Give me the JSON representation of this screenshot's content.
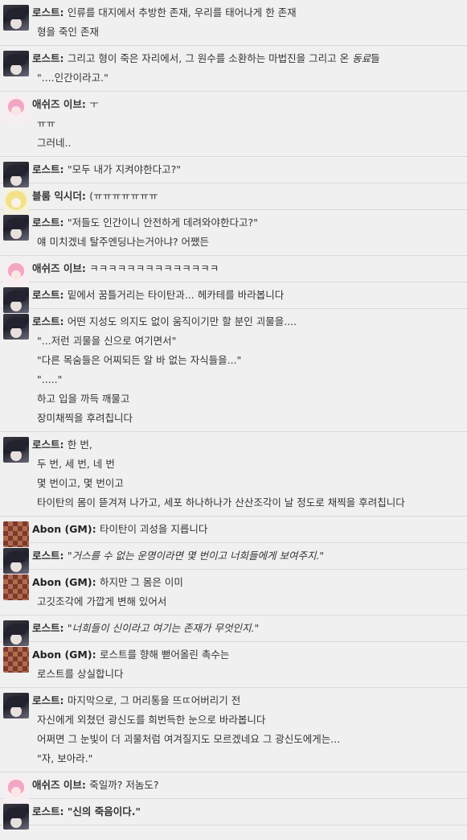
{
  "messages": [
    {
      "speaker": "로스트",
      "avatar": "rost",
      "lines": [
        {
          "segments": [
            {
              "text": "인류를 대지에서 추방한 존재, 우리를 태어나게 한 존재"
            }
          ]
        },
        {
          "segments": [
            {
              "text": "형을 죽인 존재"
            }
          ]
        }
      ]
    },
    {
      "speaker": "로스트",
      "avatar": "rost",
      "lines": [
        {
          "segments": [
            {
              "text": "그리고 형이 죽은 자리에서, 그 원수를 소환하는 마법진을 그리고 온 "
            },
            {
              "text": "동료",
              "style": "em"
            },
            {
              "text": "들"
            }
          ]
        },
        {
          "segments": [
            {
              "text": "\"....인간이라고.\""
            }
          ]
        }
      ]
    },
    {
      "speaker": "애쉬즈 이브",
      "avatar": "eve",
      "lines": [
        {
          "segments": [
            {
              "text": "ㅜ"
            }
          ]
        },
        {
          "segments": [
            {
              "text": "ㅠㅠ"
            }
          ]
        },
        {
          "segments": [
            {
              "text": "그러네.."
            }
          ]
        }
      ]
    },
    {
      "speaker": "로스트",
      "avatar": "rost",
      "lines": [
        {
          "segments": [
            {
              "text": "\"모두 내가 지켜야한다고?\""
            }
          ]
        }
      ]
    },
    {
      "speaker": "블룸 익시더",
      "avatar": "bloom",
      "lines": [
        {
          "segments": [
            {
              "text": "(ㅠㅠㅠㅠㅠㅠㅠ"
            }
          ]
        }
      ]
    },
    {
      "speaker": "로스트",
      "avatar": "rost",
      "lines": [
        {
          "segments": [
            {
              "text": "\"저들도 인간이니 안전하게 데려와야한다고?\""
            }
          ]
        },
        {
          "segments": [
            {
              "text": "얘 미치겠네 탈주엔딩나는거아냐? 어쨌든"
            }
          ]
        }
      ]
    },
    {
      "speaker": "애쉬즈 이브",
      "avatar": "eve",
      "lines": [
        {
          "segments": [
            {
              "text": "ㅋㅋㅋㅋㅋㅋㅋㅋㅋㅋㅋㅋㅋㅋ"
            }
          ]
        }
      ]
    },
    {
      "speaker": "로스트",
      "avatar": "rost",
      "lines": [
        {
          "segments": [
            {
              "text": "밑에서 꿈틀거리는 타이탄과... 헤카테를 바라봅니다"
            }
          ]
        }
      ]
    },
    {
      "speaker": "로스트",
      "avatar": "rost",
      "lines": [
        {
          "segments": [
            {
              "text": "어떤 지성도 의지도 없이 움직이기만 할 분인 괴물을...."
            }
          ]
        },
        {
          "segments": [
            {
              "text": "\"...저런 괴물을 신으로 여기면서\""
            }
          ]
        },
        {
          "segments": [
            {
              "text": "\"다른 목숨들은 어찌되든 알 바 없는 자식들을...\""
            }
          ]
        },
        {
          "segments": [
            {
              "text": "\".....\""
            }
          ]
        },
        {
          "segments": [
            {
              "text": "하고 입을 까득 깨물고"
            }
          ]
        },
        {
          "segments": [
            {
              "text": "장미채찍을 후려칩니다"
            }
          ]
        }
      ]
    },
    {
      "speaker": "로스트",
      "avatar": "rost",
      "lines": [
        {
          "segments": [
            {
              "text": "한 번,"
            }
          ]
        },
        {
          "segments": [
            {
              "text": "두 번, 세 번, 네 번"
            }
          ]
        },
        {
          "segments": [
            {
              "text": "몇 번이고, 몇 번이고"
            }
          ]
        },
        {
          "segments": [
            {
              "text": "타이탄의 몸이 뜯겨져 나가고, 세포 하나하나가 산산조각이 날 정도로 채찍을 후려칩니다"
            }
          ]
        }
      ]
    },
    {
      "speaker": "Abon (GM)",
      "avatar": "gm",
      "lines": [
        {
          "segments": [
            {
              "text": "타이탄이 괴성을 지릅니다"
            }
          ]
        }
      ]
    },
    {
      "speaker": "로스트",
      "avatar": "rost",
      "lines": [
        {
          "segments": [
            {
              "text": "\"거스를 수 없는 운명이라면 몇 번이고 너희들에게 보여주지.\"",
              "style": "em"
            }
          ]
        }
      ]
    },
    {
      "speaker": "Abon (GM)",
      "avatar": "gm",
      "lines": [
        {
          "segments": [
            {
              "text": "하지만 그 몸은 이미"
            }
          ]
        },
        {
          "segments": [
            {
              "text": "고깃조각에 가깝게 변해 있어서"
            }
          ]
        }
      ]
    },
    {
      "speaker": "로스트",
      "avatar": "rost",
      "lines": [
        {
          "segments": [
            {
              "text": "\"너희들이 신이라고 여기는 존재가 무엇인지.\"",
              "style": "em"
            }
          ]
        }
      ]
    },
    {
      "speaker": "Abon (GM)",
      "avatar": "gm",
      "lines": [
        {
          "segments": [
            {
              "text": "로스트를 향해 뻗어올린 촉수는"
            }
          ]
        },
        {
          "segments": [
            {
              "text": "로스트를 상실합니다"
            }
          ]
        }
      ]
    },
    {
      "speaker": "로스트",
      "avatar": "rost",
      "lines": [
        {
          "segments": [
            {
              "text": "마지막으로, 그 머리통을 뜨ㄸ어버리기 전"
            }
          ]
        },
        {
          "segments": [
            {
              "text": "자신에게 외쳤던 광신도를 희번득한 눈으로 바라봅니다"
            }
          ]
        },
        {
          "segments": [
            {
              "text": "어쩌면 그 눈빛이 더 괴물처럼 여겨질지도 모르겠네요 그 광신도에게는..."
            }
          ]
        },
        {
          "segments": [
            {
              "text": "\"자, 보아라.\""
            }
          ]
        }
      ]
    },
    {
      "speaker": "애쉬즈 이브",
      "avatar": "eve",
      "lines": [
        {
          "segments": [
            {
              "text": "죽일까? 저놈도?"
            }
          ]
        }
      ]
    },
    {
      "speaker": "로스트",
      "avatar": "rost",
      "lines": [
        {
          "segments": [
            {
              "text": "\"신의 죽음이다.\"",
              "style": "bold"
            }
          ]
        }
      ]
    }
  ]
}
